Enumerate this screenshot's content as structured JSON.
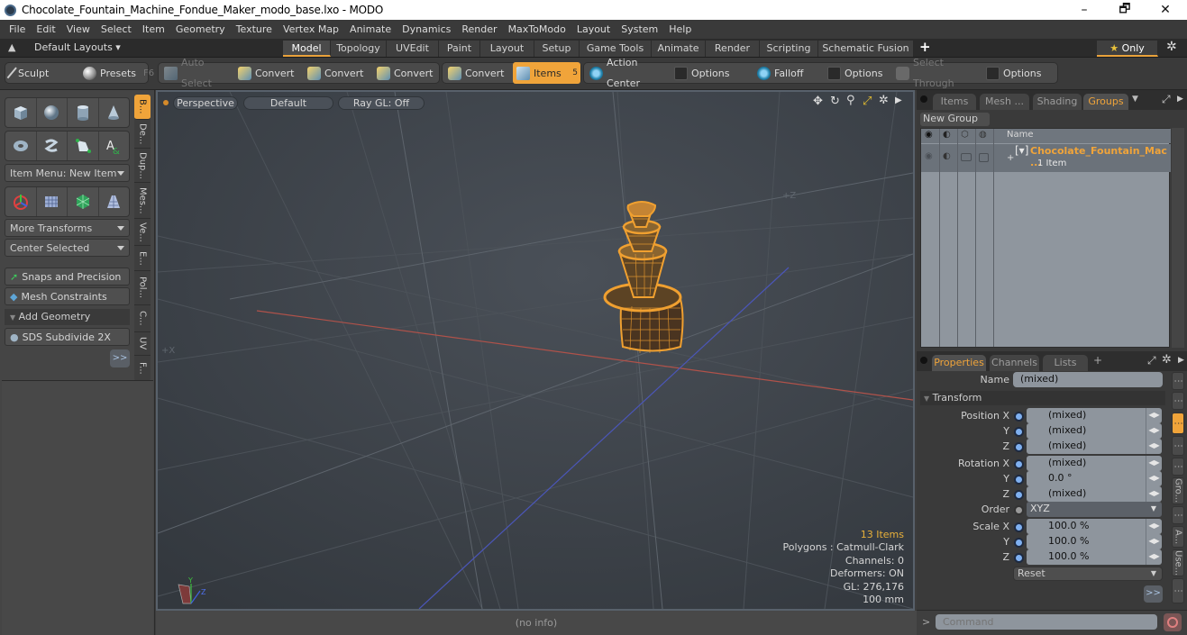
{
  "window": {
    "title": "Chocolate_Fountain_Machine_Fondue_Maker_modo_base.lxo - MODO",
    "minimize_label": "–",
    "restore_label": "🗗",
    "close_label": "✕"
  },
  "menubar": [
    "File",
    "Edit",
    "View",
    "Select",
    "Item",
    "Geometry",
    "Texture",
    "Vertex Map",
    "Animate",
    "Dynamics",
    "Render",
    "MaxToModo",
    "Layout",
    "System",
    "Help"
  ],
  "layoutbar": {
    "layouts_label": "Default Layouts ▾",
    "tabs": [
      "Model",
      "Topology",
      "UVEdit",
      "Paint",
      "Layout",
      "Setup",
      "Game Tools",
      "Animate",
      "Render",
      "Scripting",
      "Schematic Fusion"
    ],
    "active_tab": "Model",
    "add_label": "+",
    "only_label": "Only",
    "accent": "#e9a23b"
  },
  "toolbar": {
    "sculpt": "Sculpt",
    "presets": "Presets",
    "presets_key": "F6",
    "auto_select": "Auto Select",
    "convert1": "Convert",
    "convert2": "Convert",
    "convert3": "Convert",
    "convert4": "Convert",
    "items": "Items",
    "items_count": "5",
    "action_center": "Action Center",
    "options1": "Options",
    "falloff": "Falloff",
    "options2": "Options",
    "select_through": "Select Through",
    "options3": "Options"
  },
  "leftpanel": {
    "item_menu": "Item Menu: New Item",
    "more_transforms": "More Transforms",
    "center_selected": "Center Selected",
    "snaps": "Snaps and Precision",
    "mesh_constraints": "Mesh Constraints",
    "add_geometry": "Add Geometry",
    "sds_subdivide": "SDS Subdivide 2X",
    "more": ">>",
    "vtabs": [
      "B...",
      "De...",
      "Dup...",
      "Mes...",
      "Ve...",
      "E...",
      "Pol...",
      "C...",
      "UV",
      "F..."
    ]
  },
  "viewport": {
    "view_mode": "Perspective",
    "shading": "Default",
    "raygl": "Ray GL: Off",
    "axis_x_label": "+X",
    "axis_z_label": "+Z",
    "hud": {
      "items": "13 Items",
      "polygons": "Polygons : Catmull-Clark",
      "channels": "Channels: 0",
      "deformers": "Deformers: ON",
      "gl": "GL: 276,176",
      "scale": "100 mm"
    },
    "model_color": "#f0a030"
  },
  "statusbar": {
    "info": "(no info)"
  },
  "rightpanel": {
    "top_tabs": [
      "Items",
      "Mesh ...",
      "Shading",
      "Groups"
    ],
    "top_active": "Groups",
    "new_group": "New Group",
    "name_header": "Name",
    "group_name": "Chocolate_Fountain_Mac ...",
    "group_count": "1 Item",
    "prop_tabs": [
      "Properties",
      "Channels",
      "Lists"
    ],
    "prop_active": "Properties",
    "add_tab": "+",
    "name_label": "Name",
    "name_value": "(mixed)",
    "transform_label": "Transform",
    "position": {
      "label_x": "Position X",
      "label_y": "Y",
      "label_z": "Z",
      "x": "(mixed)",
      "y": "(mixed)",
      "z": "(mixed)"
    },
    "rotation": {
      "label_x": "Rotation X",
      "label_y": "Y",
      "label_z": "Z",
      "x": "(mixed)",
      "y": "0.0 °",
      "z": "(mixed)"
    },
    "order": {
      "label": "Order",
      "value": "XYZ"
    },
    "scale": {
      "label_x": "Scale X",
      "label_y": "Y",
      "label_z": "Z",
      "x": "100.0 %",
      "y": "100.0 %",
      "z": "100.0 %"
    },
    "reset": "Reset",
    "more": ">>",
    "side_tabs": [
      "Gro...",
      "A...",
      "Use..."
    ],
    "command_prompt": ">",
    "command_placeholder": "Command"
  }
}
